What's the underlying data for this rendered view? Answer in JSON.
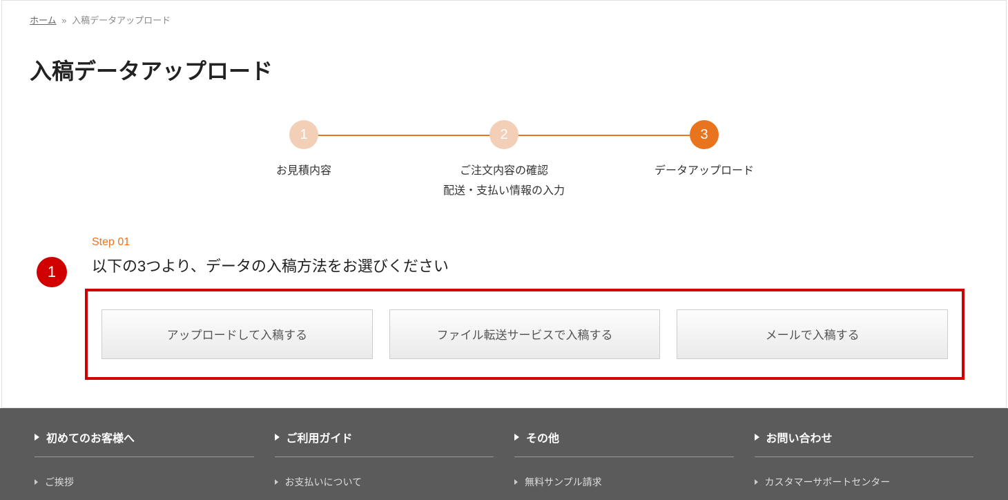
{
  "breadcrumb": {
    "home": "ホーム",
    "sep": "»",
    "current": "入稿データアップロード"
  },
  "page_title": "入稿データアップロード",
  "progress": {
    "steps": [
      {
        "num": "1",
        "label": "お見積内容",
        "active": false
      },
      {
        "num": "2",
        "label": "ご注文内容の確認\n配送・支払い情報の入力",
        "active": false
      },
      {
        "num": "3",
        "label": "データアップロード",
        "active": true
      }
    ]
  },
  "step_section": {
    "badge": "1",
    "mini": "Step 01",
    "heading": "以下の3つより、データの入稿方法をお選びください",
    "options": [
      "アップロードして入稿する",
      "ファイル転送サービスで入稿する",
      "メールで入稿する"
    ]
  },
  "footer": {
    "cols": [
      {
        "head": "初めてのお客様へ",
        "items": [
          "ご挨拶"
        ]
      },
      {
        "head": "ご利用ガイド",
        "items": [
          "お支払いについて"
        ]
      },
      {
        "head": "その他",
        "items": [
          "無料サンプル請求"
        ]
      },
      {
        "head": "お問い合わせ",
        "items": [
          "カスタマーサポートセンター"
        ]
      }
    ]
  }
}
